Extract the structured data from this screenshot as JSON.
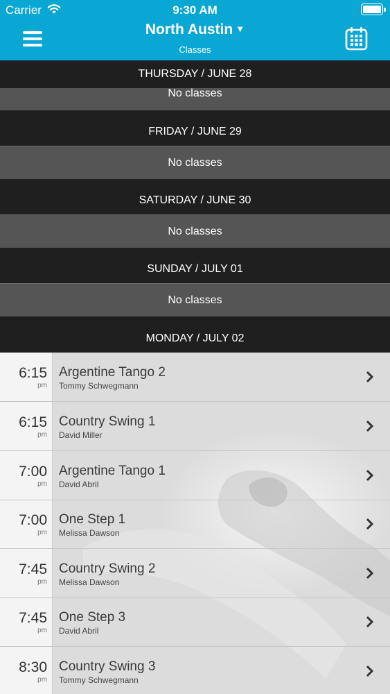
{
  "status_bar": {
    "carrier": "Carrier",
    "time": "9:30 AM"
  },
  "header": {
    "location": "North Austin",
    "caret": "▼",
    "subtitle": "Classes",
    "menu_icon": "hamburger-icon",
    "calendar_icon": "calendar-icon"
  },
  "days": [
    {
      "label": "THURSDAY / JUNE 28",
      "empty_text": "No classes"
    },
    {
      "label": "FRIDAY / JUNE 29",
      "empty_text": "No classes"
    },
    {
      "label": "SATURDAY / JUNE 30",
      "empty_text": "No classes"
    },
    {
      "label": "SUNDAY / JULY 01",
      "empty_text": "No classes"
    },
    {
      "label": "MONDAY / JULY 02"
    }
  ],
  "classes": [
    {
      "time": "6:15",
      "ampm": "pm",
      "title": "Argentine Tango 2",
      "instructor": "Tommy Schwegmann"
    },
    {
      "time": "6:15",
      "ampm": "pm",
      "title": "Country Swing 1",
      "instructor": "David Miller"
    },
    {
      "time": "7:00",
      "ampm": "pm",
      "title": "Argentine Tango 1",
      "instructor": "David Abril"
    },
    {
      "time": "7:00",
      "ampm": "pm",
      "title": "One Step 1",
      "instructor": "Melissa Dawson"
    },
    {
      "time": "7:45",
      "ampm": "pm",
      "title": "Country Swing 2",
      "instructor": "Melissa Dawson"
    },
    {
      "time": "7:45",
      "ampm": "pm",
      "title": "One Step 3",
      "instructor": "David Abril"
    },
    {
      "time": "8:30",
      "ampm": "pm",
      "title": "Country Swing 3",
      "instructor": "Tommy Schwegmann"
    }
  ],
  "colors": {
    "header_bg": "#0aa6d4",
    "day_header_bg": "#1f1f1f",
    "no_classes_bg": "#555555"
  }
}
